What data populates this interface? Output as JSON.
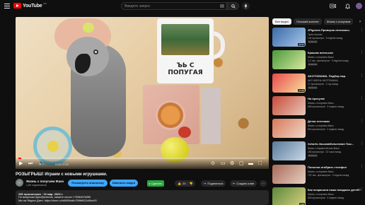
{
  "header": {
    "logo_text": "YouTube",
    "logo_country": "RU",
    "search_placeholder": "Введите запрос"
  },
  "player": {
    "mug_text": "ЪЬ С ПОПУГАЯ",
    "time": "0:00 / 2:00",
    "progress": 0.01
  },
  "video": {
    "title": "РОЗЫГРЫШ! Играем с новыми игрушками.",
    "channel_name": "Жизнь с попугаем Жако",
    "subscribers": "1,6K подписчиков",
    "analytics_button": "Посмотреть аналитику",
    "edit_button": "Изменить видео",
    "badge_label": "Сделать",
    "likes": "23",
    "share": "Поделиться",
    "clip": "Создать клип"
  },
  "description": {
    "meta": "296 просмотров · 16 мар. 2023 г.",
    "line1": "По вопросам приобретения, пишите лесли +79284676955",
    "line2": "Мы на Яндекс.Дзен: https://dzen.ru/id/609ba8c7f5ffbf012c8fac93"
  },
  "sidebar": {
    "chips": [
      {
        "label": "Все видео",
        "active": true
      },
      {
        "label": "Похожий контент",
        "active": false
      },
      {
        "label": "Жизнь с попугаем",
        "active": false
      }
    ],
    "items": [
      {
        "title": "#Pigeons.Проверка лесникоы.",
        "channel": "Тугеи Альпин",
        "meta": "144 просмотра · 3 недели назад",
        "badge": "Новинка",
        "duration": "23:37",
        "thumb_colors": [
          "#3a6aa8",
          "#a8c8e8"
        ]
      },
      {
        "title": "Крашим апельсин",
        "channel": "Жизнь с попугаем Жако",
        "meta": "1,2 тыс. просмотров · 3 недели назад",
        "badge": "Новинка",
        "duration": "",
        "thumb_colors": [
          "#4a9a3a",
          "#d8e8a0"
        ]
      },
      {
        "title": "AKOTOMANIA. Подбор пар.",
        "channel": "AKO ЖИЗНЬ AKOTOMANIA",
        "meta": "17 просмотров · 1 год назад",
        "badge": "Новинка",
        "duration": "17:25",
        "thumb_colors": [
          "#e84a4a",
          "#f8e0a0"
        ]
      },
      {
        "title": "На прогулке",
        "channel": "Жизнь с попугаем Жако",
        "meta": "606 просмотров · 3 недели назад",
        "badge": "",
        "duration": "",
        "thumb_colors": [
          "#c84a3a",
          "#e8c8b8"
        ]
      },
      {
        "title": "Детки птенчики",
        "channel": "Жизнь с попугаем Жако",
        "meta": "816 просмотров · 2 недели назад",
        "badge": "",
        "duration": "",
        "thumb_colors": [
          "#d8785a",
          "#f0d8c8"
        ]
      },
      {
        "title": "#shorts #вызовИспытание.Тош...",
        "channel": "Жизнь с Кармелой моя Жако",
        "meta": "183 просмотра · 22 часа назад",
        "badge": "Новинка",
        "duration": "",
        "thumb_colors": [
          "#5a7a9a",
          "#c8d8e8"
        ]
      },
      {
        "title": "Попытка отобрать телефон",
        "channel": "Жизнь с попугаем Жако",
        "meta": "722 тыс. просмотров · 2 недели назад",
        "badge": "",
        "duration": "",
        "thumb_colors": [
          "#a86a5a",
          "#e8d0c0"
        ]
      },
      {
        "title": "Как покрасили наши младших детей?",
        "channel": "Жизнь с попугаем Жако",
        "meta": "606 просмотров · 3 недели назад",
        "badge": "",
        "duration": "3:00",
        "thumb_colors": [
          "#5a8a3a",
          "#d8d080"
        ]
      }
    ]
  }
}
